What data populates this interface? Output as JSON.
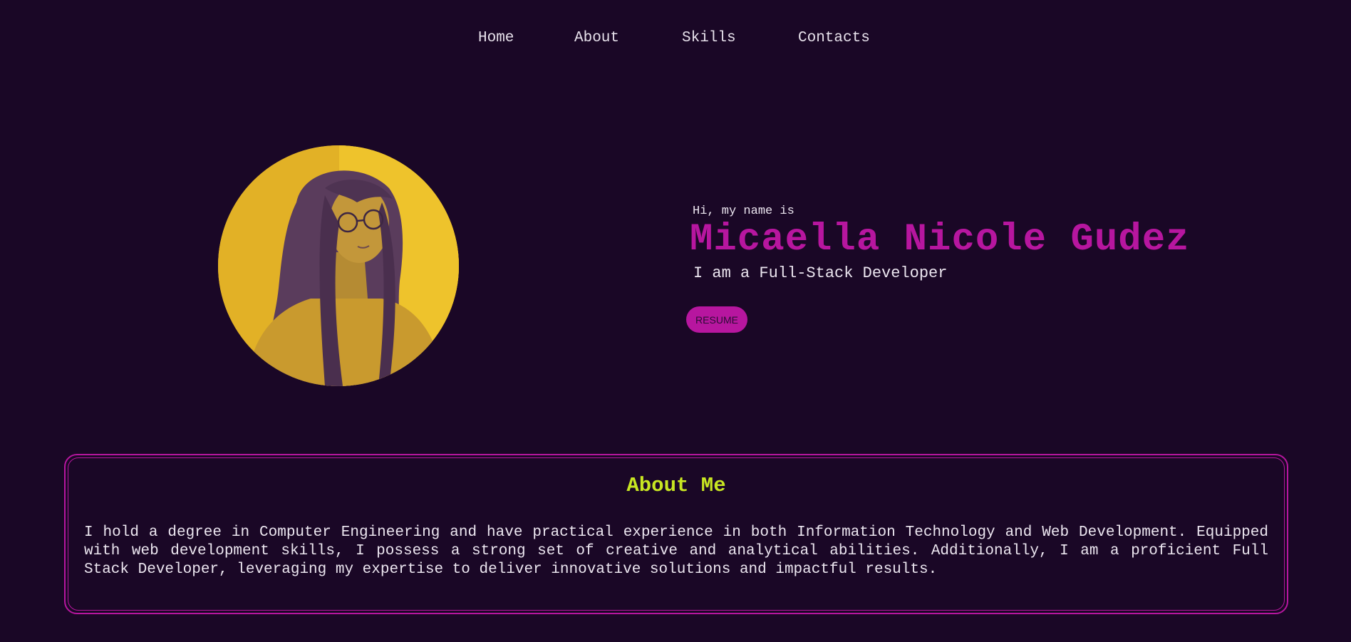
{
  "nav": {
    "items": [
      {
        "label": "Home"
      },
      {
        "label": "About"
      },
      {
        "label": "Skills"
      },
      {
        "label": "Contacts"
      }
    ]
  },
  "hero": {
    "greeting": "Hi, my name is",
    "name": "Micaella Nicole Gudez",
    "role": "I am a Full-Stack Developer",
    "resume_label": "RESUME"
  },
  "about": {
    "title": "About Me",
    "text": "I hold a degree in Computer Engineering and have practical experience in both Information Technology and Web Development. Equipped with web development skills, I possess a strong set of creative and analytical abilities. Additionally, I am a proficient Full Stack Developer, leveraging my expertise to deliver innovative solutions and impactful results."
  },
  "colors": {
    "background": "#1a0726",
    "accent": "#b7169f",
    "heading": "#c8e622",
    "text": "#ece6f0",
    "photo_tint": "#e8ba25"
  }
}
